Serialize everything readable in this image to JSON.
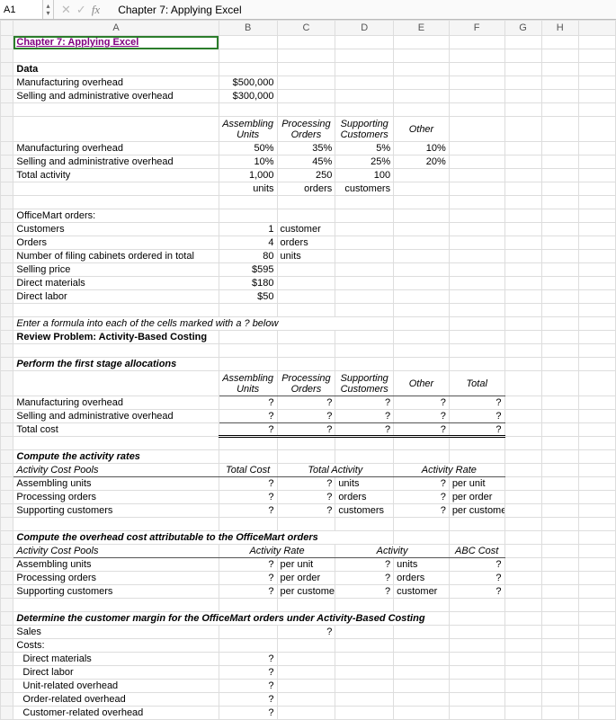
{
  "nameBox": "A1",
  "fxLabel": "fx",
  "formulaText": "Chapter 7: Applying Excel",
  "colHeaders": [
    "A",
    "B",
    "C",
    "D",
    "E",
    "F",
    "G",
    "H"
  ],
  "title": "Chapter 7: Applying Excel",
  "dataLabel": "Data",
  "row4": {
    "a": "Manufacturing overhead",
    "b": "$500,000"
  },
  "row5": {
    "a": "Selling and administrative overhead",
    "b": "$300,000"
  },
  "hdr1": {
    "b": "Assembling Units",
    "c": "Processing Orders",
    "d": "Supporting Customers",
    "e": "Other"
  },
  "row8": {
    "a": "Manufacturing overhead",
    "b": "50%",
    "c": "35%",
    "d": "5%",
    "e": "10%"
  },
  "row9": {
    "a": "Selling and administrative overhead",
    "b": "10%",
    "c": "45%",
    "d": "25%",
    "e": "20%"
  },
  "row10": {
    "a": "Total activity",
    "b": "1,000",
    "c": "250",
    "d": "100"
  },
  "row11": {
    "b": "units",
    "c": "orders",
    "d": "customers"
  },
  "row13": {
    "a": "OfficeMart orders:"
  },
  "row14": {
    "a": "Customers",
    "b": "1",
    "c": "customer"
  },
  "row15": {
    "a": "Orders",
    "b": "4",
    "c": "orders"
  },
  "row16": {
    "a": "Number of filing cabinets ordered in total",
    "b": "80",
    "c": "units"
  },
  "row17": {
    "a": "Selling price",
    "b": "$595"
  },
  "row18": {
    "a": "Direct materials",
    "b": "$180"
  },
  "row19": {
    "a": "Direct labor",
    "b": "$50"
  },
  "row21": {
    "a": "Enter a formula into each of the cells marked with a ? below"
  },
  "row22": {
    "a": "Review Problem: Activity-Based Costing"
  },
  "row24": {
    "a": "Perform the first stage allocations"
  },
  "hdr2": {
    "b": "Assembling Units",
    "c": "Processing Orders",
    "d": "Supporting Customers",
    "e": "Other",
    "f": "Total"
  },
  "row26": {
    "a": "Manufacturing overhead",
    "b": "?",
    "c": "?",
    "d": "?",
    "e": "?",
    "f": "?"
  },
  "row27": {
    "a": "Selling and administrative overhead",
    "b": "?",
    "c": "?",
    "d": "?",
    "e": "?",
    "f": "?"
  },
  "row28": {
    "a": "Total cost",
    "b": "?",
    "c": "?",
    "d": "?",
    "e": "?",
    "f": "?"
  },
  "row30": {
    "a": "Compute the activity rates"
  },
  "row31": {
    "a": "Activity Cost Pools",
    "b": "Total Cost",
    "c": "",
    "d": "Total Activity",
    "f": "Activity Rate"
  },
  "row32": {
    "a": "Assembling units",
    "b": "?",
    "c": "?",
    "d": "units",
    "e": "?",
    "f": "per unit"
  },
  "row33": {
    "a": "Processing orders",
    "b": "?",
    "c": "?",
    "d": "orders",
    "e": "?",
    "f": "per order"
  },
  "row34": {
    "a": "Supporting customers",
    "b": "?",
    "c": "?",
    "d": "customers",
    "e": "?",
    "f": "per customer"
  },
  "row36": {
    "a": "Compute the overhead cost attributable to the OfficeMart orders"
  },
  "row37": {
    "a": "Activity Cost Pools",
    "c": "Activity Rate",
    "e": "Activity",
    "f": "ABC Cost"
  },
  "row38": {
    "a": "Assembling units",
    "b": "?",
    "c": "per unit",
    "d": "?",
    "e": "units",
    "f": "?"
  },
  "row39": {
    "a": "Processing orders",
    "b": "?",
    "c": "per order",
    "d": "?",
    "e": "orders",
    "f": "?"
  },
  "row40": {
    "a": "Supporting customers",
    "b": "?",
    "c": "per customer",
    "d": "?",
    "e": "customer",
    "f": "?"
  },
  "row42": {
    "a": "Determine the customer margin for the OfficeMart orders under Activity-Based Costing"
  },
  "row43": {
    "a": "Sales",
    "c": "?"
  },
  "row44": {
    "a": "Costs:"
  },
  "row45": {
    "a": "Direct materials",
    "b": "?"
  },
  "row46": {
    "a": "Direct labor",
    "b": "?"
  },
  "row47": {
    "a": "Unit-related overhead",
    "b": "?"
  },
  "row48": {
    "a": "Order-related overhead",
    "b": "?"
  },
  "row49": {
    "a": "Customer-related overhead",
    "b": "?"
  }
}
